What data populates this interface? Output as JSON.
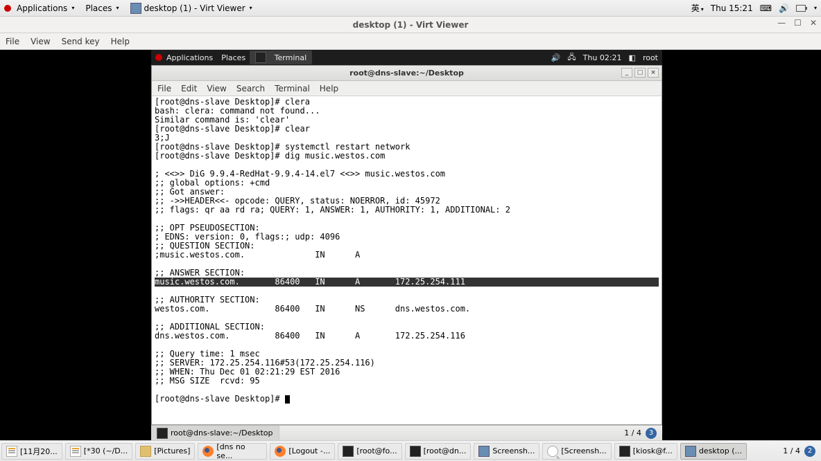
{
  "host": {
    "menu_apps": "Applications",
    "menu_places": "Places",
    "active_task": "desktop (1) - Virt Viewer",
    "ime": "英",
    "clock": "Thu 15:21"
  },
  "virt": {
    "title": "desktop (1) - Virt Viewer",
    "menu_file": "File",
    "menu_view": "View",
    "menu_sendkey": "Send key",
    "menu_help": "Help"
  },
  "guest": {
    "menu_apps": "Applications",
    "menu_places": "Places",
    "active_task": "Terminal",
    "clock": "Thu 02:21",
    "user": "root",
    "termwin_title": "root@dns-slave:~/Desktop",
    "term_menu_file": "File",
    "term_menu_edit": "Edit",
    "term_menu_view": "View",
    "term_menu_search": "Search",
    "term_menu_terminal": "Terminal",
    "term_menu_help": "Help",
    "bottom_task": "root@dns-slave:~/Desktop",
    "workspace": "1 / 4"
  },
  "terminal_lines": [
    "[root@dns-slave Desktop]# clera",
    "bash: clera: command not found...",
    "Similar command is: 'clear'",
    "[root@dns-slave Desktop]# clear",
    "\u001b3;J",
    "[root@dns-slave Desktop]# systemctl restart network",
    "[root@dns-slave Desktop]# dig music.westos.com",
    "",
    "; <<>> DiG 9.9.4-RedHat-9.9.4-14.el7 <<>> music.westos.com",
    ";; global options: +cmd",
    ";; Got answer:",
    ";; ->>HEADER<<- opcode: QUERY, status: NOERROR, id: 45972",
    ";; flags: qr aa rd ra; QUERY: 1, ANSWER: 1, AUTHORITY: 1, ADDITIONAL: 2",
    "",
    ";; OPT PSEUDOSECTION:",
    "; EDNS: version: 0, flags:; udp: 4096",
    ";; QUESTION SECTION:",
    ";music.westos.com.              IN      A",
    "",
    ";; ANSWER SECTION:"
  ],
  "terminal_highlight": "music.westos.com.       86400   IN      A       172.25.254.111",
  "terminal_lines2": [
    "",
    ";; AUTHORITY SECTION:",
    "westos.com.             86400   IN      NS      dns.westos.com.",
    "",
    ";; ADDITIONAL SECTION:",
    "dns.westos.com.         86400   IN      A       172.25.254.116",
    "",
    ";; Query time: 1 msec",
    ";; SERVER: 172.25.254.116#53(172.25.254.116)",
    ";; WHEN: Thu Dec 01 02:21:29 EST 2016",
    ";; MSG SIZE  rcvd: 95",
    "",
    "[root@dns-slave Desktop]# "
  ],
  "host_tasks": [
    {
      "icon": "txt-icon",
      "label": "[11月20..."
    },
    {
      "icon": "txt-icon",
      "label": "[*30 (~/D..."
    },
    {
      "icon": "folder-icon",
      "label": "[Pictures]"
    },
    {
      "icon": "ff-icon",
      "label": "[dns no se..."
    },
    {
      "icon": "ff-icon",
      "label": "[Logout -..."
    },
    {
      "icon": "term-icon",
      "label": "[root@fo..."
    },
    {
      "icon": "term-icon",
      "label": "[root@dn..."
    },
    {
      "icon": "screen-icon",
      "label": "Screensh..."
    },
    {
      "icon": "search-icon",
      "label": "[Screensh..."
    },
    {
      "icon": "term-icon",
      "label": "[kiosk@f..."
    },
    {
      "icon": "screen-icon",
      "label": "desktop (...",
      "active": true
    }
  ],
  "host_workspace": "1 / 4"
}
